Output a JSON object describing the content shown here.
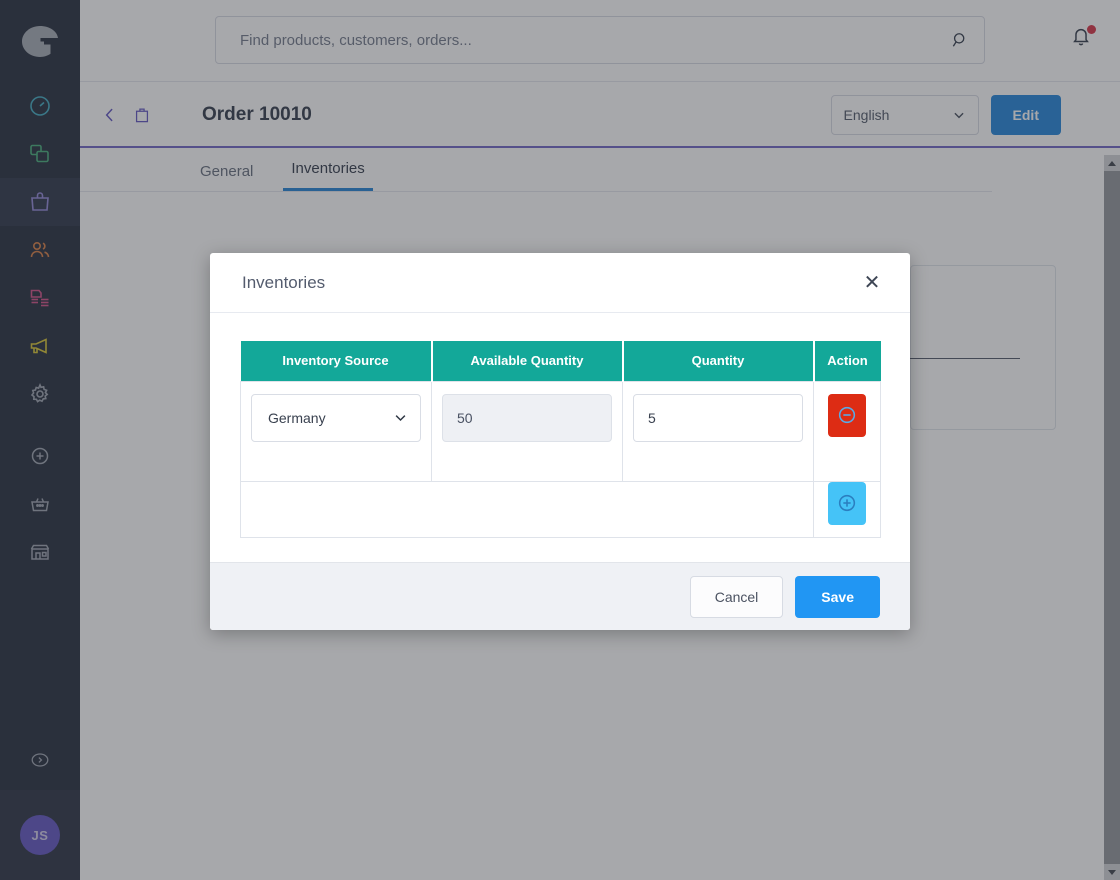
{
  "colors": {
    "sidebar_bg": "#1d2535",
    "sidebar_active": "#262f42",
    "accent_purple": "#5b4fc0",
    "primary_blue": "#2196f3",
    "edit_blue": "#1a80d9",
    "table_header_teal": "#13a899",
    "remove_red": "#dd2c14",
    "add_blue": "#45c3f7",
    "notification_dot": "#d62b3f"
  },
  "sidebar": {
    "logo_name": "sylius-logo",
    "items": [
      {
        "icon": "dashboard-icon",
        "color": "#3aa6bd",
        "active": false
      },
      {
        "icon": "catalog-icon",
        "color": "#3faa75",
        "active": false
      },
      {
        "icon": "orders-bag-icon",
        "color": "#8e84d8",
        "active": true
      },
      {
        "icon": "customers-icon",
        "color": "#d5783c",
        "active": false
      },
      {
        "icon": "content-icon",
        "color": "#cf4a83",
        "active": false
      },
      {
        "icon": "marketing-megaphone-icon",
        "color": "#d7c32b",
        "active": false
      },
      {
        "icon": "configuration-gear-icon",
        "color": "#9aa0ad",
        "active": false
      }
    ],
    "secondary_items": [
      {
        "icon": "plus-circle-icon",
        "color": "#9aa0ad"
      },
      {
        "icon": "basket-icon",
        "color": "#9aa0ad"
      },
      {
        "icon": "store-icon",
        "color": "#9aa0ad"
      }
    ],
    "expand_icon": "chevron-right-circle-icon",
    "avatar_initials": "JS"
  },
  "topbar": {
    "search_placeholder": "Find products, customers, orders...",
    "search_value": "",
    "search_icon": "search-icon",
    "bell_icon": "bell-icon",
    "has_notification": true
  },
  "pagehead": {
    "back_icon": "chevron-left-icon",
    "bag_icon": "bag-icon",
    "title": "Order 10010",
    "language_value": "English",
    "language_chevron": "chevron-down-icon",
    "edit_label": "Edit"
  },
  "tabs": [
    {
      "label": "General",
      "active": false
    },
    {
      "label": "Inventories",
      "active": true
    }
  ],
  "modal": {
    "title": "Inventories",
    "close_icon": "close-icon",
    "table": {
      "headers": [
        "Inventory Source",
        "Available Quantity",
        "Quantity",
        "Action"
      ],
      "rows": [
        {
          "inventory_source": "Germany",
          "source_chevron": "chevron-down-icon",
          "available_quantity": "50",
          "available_disabled": true,
          "quantity": "5",
          "action_icon": "minus-circle-icon"
        }
      ],
      "add_row_icon": "plus-circle-icon"
    },
    "cancel_label": "Cancel",
    "save_label": "Save"
  },
  "scrollbar": {
    "up_icon": "triangle-up-icon",
    "down_icon": "triangle-down-icon"
  }
}
